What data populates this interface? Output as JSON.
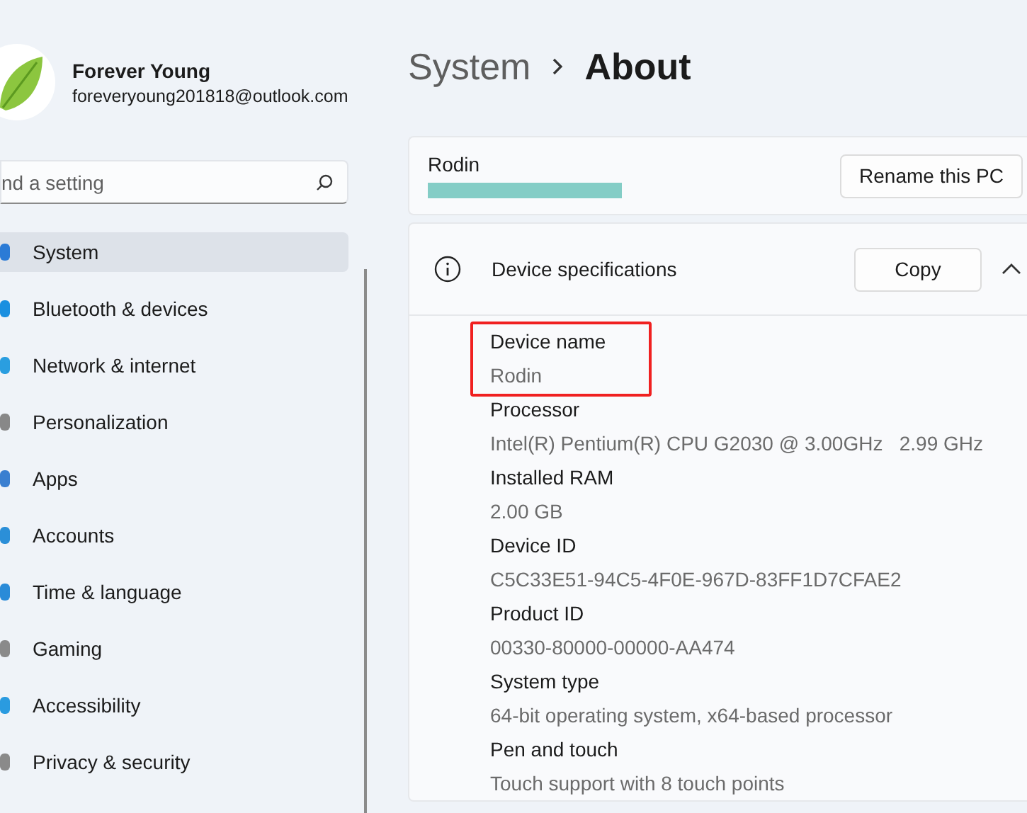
{
  "account": {
    "name": "Forever Young",
    "email": "foreveryoung201818@outlook.com"
  },
  "search": {
    "placeholder": "nd a setting"
  },
  "nav": [
    {
      "label": "System",
      "selected": true
    },
    {
      "label": "Bluetooth & devices",
      "selected": false
    },
    {
      "label": "Network & internet",
      "selected": false
    },
    {
      "label": "Personalization",
      "selected": false
    },
    {
      "label": "Apps",
      "selected": false
    },
    {
      "label": "Accounts",
      "selected": false
    },
    {
      "label": "Time & language",
      "selected": false
    },
    {
      "label": "Gaming",
      "selected": false
    },
    {
      "label": "Accessibility",
      "selected": false
    },
    {
      "label": "Privacy & security",
      "selected": false
    }
  ],
  "breadcrumb": [
    {
      "label": "System",
      "current": false
    },
    {
      "label": "About",
      "current": true
    }
  ],
  "pc": {
    "name": "Rodin",
    "redacted": true,
    "button": "Rename this PC"
  },
  "specs": {
    "title": "Device specifications",
    "copy": "Copy",
    "expanded": true,
    "items": [
      {
        "label": "Device name",
        "value": "Rodin",
        "highlighted": true
      },
      {
        "label": "Processor",
        "value": "Intel(R) Pentium(R) CPU G2030 @ 3.00GHz   2.99 GHz",
        "highlighted": false
      },
      {
        "label": "Installed RAM",
        "value": "2.00 GB",
        "highlighted": false
      },
      {
        "label": "Device ID",
        "value": "C5C33E51-94C5-4F0E-967D-83FF1D7CFAE2",
        "highlighted": false
      },
      {
        "label": "Product ID",
        "value": "00330-80000-00000-AA474",
        "highlighted": false
      },
      {
        "label": "System type",
        "value": "64-bit operating system, x64-based processor",
        "highlighted": false
      },
      {
        "label": "Pen and touch",
        "value": "Touch support with 8 touch points",
        "highlighted": false
      }
    ]
  }
}
